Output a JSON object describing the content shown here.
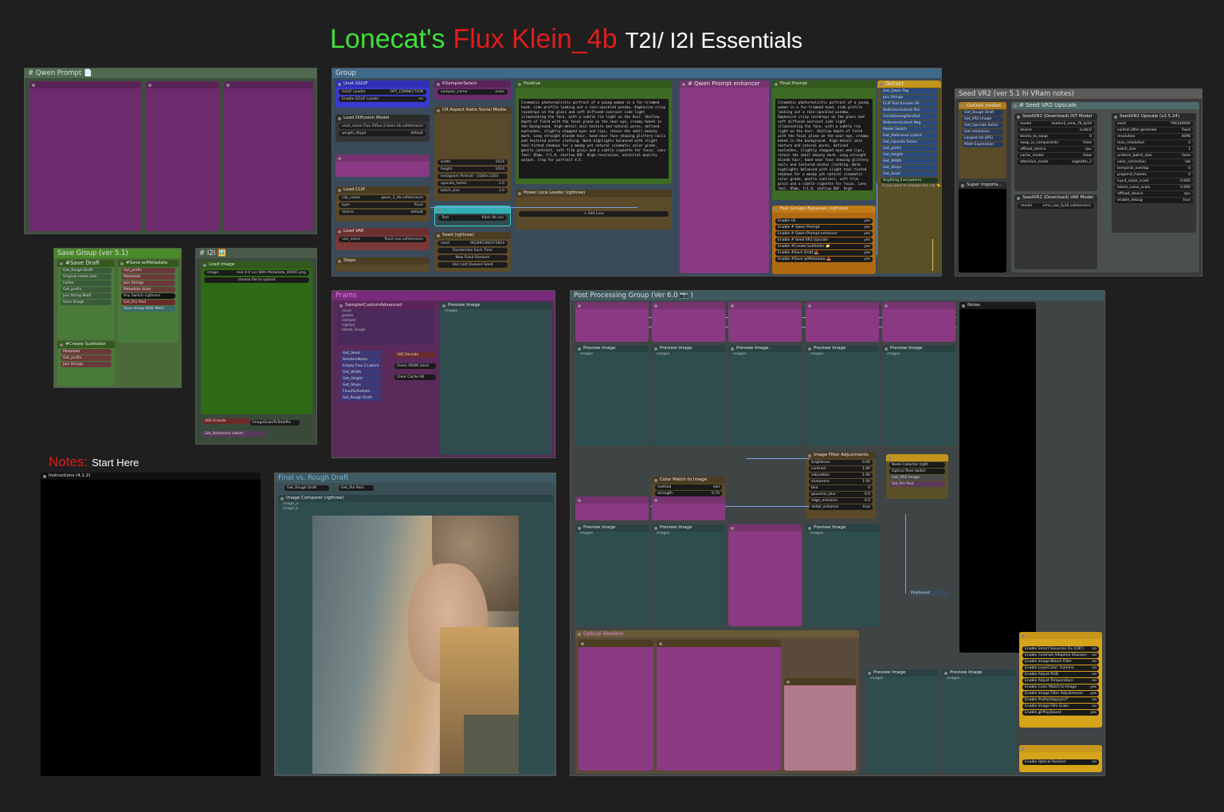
{
  "header": {
    "part1": "Lonecat's",
    "part2": "Flux Klein_4b",
    "part3": "T2I/ I2I Essentials"
  },
  "notes": {
    "label": "Notes:",
    "start": "Start Here"
  },
  "groups": {
    "qwen_prompt": "#  Qwen Prompt 📄",
    "group": "Group",
    "qwen_enhancer": "# Qwen Prompt enhancer",
    "getset": "Getset",
    "seedvr2": "Seed VR2 (ver 5.1 hi VRam notes)",
    "getset_nodes": "Getset nodes",
    "seedvr2_upscale": "# Seed VR2 Upscale",
    "save_group": "Save Group (ver 5.1)",
    "i2i": "#  I2I 🖼️",
    "prams": "Prams",
    "post": "Post Processing Group (Ver 6.0 📷 )",
    "final_vs": "Final vs. Rough Draft",
    "optical": "Optical Realism"
  },
  "nodes": {
    "gguf_loader": "Unet GGUF",
    "gguf_widget": "GGUF Loader",
    "gguf_out": "OPT_CONNECTION",
    "enable_gguf": "Enable GGUF Loader",
    "load_diffusion": "Load Diffusion Model",
    "unet_name": "unet_name",
    "unet_value": "Flux 2\\flux-2-klein-4b.safetensors",
    "weight_dtype": "weight_dtype",
    "weight_value": "default",
    "load_clip": "Load CLIP",
    "clip_name": "clip_name",
    "clip_value": "qwen_3_4b.safetensors",
    "type": "type",
    "type_value": "flux2",
    "device": "device",
    "device_value": "default",
    "load_vae": "Load VAE",
    "vae_name": "vae_name",
    "vae_value": "flux2-vae.safetensors",
    "steps": "Steps",
    "ksampler_select": "KSamplerSelect",
    "sampler_name": "sampler_name",
    "sampler_value": "euler",
    "aspect": "CR Aspect Ratio Social Media",
    "width": "width",
    "width_value": "1024",
    "height": "height",
    "height_value": "1024",
    "aspect_ratio": "Instagram Portrait - 1080×1350",
    "upscale_factor": "upscale_factor",
    "batch_size": "batch_size",
    "one": "1.0",
    "positive": "Positive",
    "positive_text": "Cinematic photorealistic portrait of a young woman in a fur-trimmed hood, side profile looking out a rain-speckled window. Emphasize crisp raindrops on the glass and soft diffused overcast side light illuminating the face, with a subtle rim light on the hair. Shallow depth of field with the focal plane on the near eye, creamy bokeh in the background. High-detail skin texture and natural pores, defined eyelashes, slightly chapped eyes and lips, retain the small beauty mark. Long straight blonde hair, hand near face showing glittery nails and textured winter clothing. Warm highlights balanced with slight teal-tinted shadows for a moody yet natural cinematic color grade, gentle contrast, soft film grain and a subtle vignette for focus. Lens feel: 85mm, f/1.8, shallow DOF. High-resolution, editorial-quality output. Crop for portrait 4:5.",
    "power_lora": "Power Lora Loader (rgthree)",
    "add_lora": "+ Add Lora",
    "text_label": "Text",
    "klein_run": "Klein 4b run",
    "seed": "Seed (rgthree)",
    "seed_value": "962895366375824",
    "randomize": "Randomize Each Time",
    "new_fixed": "New Fixed Random",
    "use_last": "Use Last Queued Seed",
    "final_prompt": "Final Prompt",
    "fast_groups": "Fast Groups Bypasser (rgthree)",
    "bypass_items": [
      "Enable I2I",
      "Enable # Qwen Prompt",
      "Enable # Qwen Prompt enhancer",
      "Enable # Seed VR2 Upscale",
      "Enable #Create Subfolder 📁",
      "Enable #Save Draft 📥",
      "Enable #Save w/Metadata 📥"
    ],
    "yes": "yes",
    "no": "no",
    "getset_items": [
      "Get_Qwen Tag",
      "Join Strings",
      "CLIP Text Encode (Pr",
      "ReferenceLatent Pos",
      "ConditioningZeroOut",
      "ReferenceLatent Neg",
      "Model Switch",
      "Get_Reference Latent",
      "Get_Upscale factor",
      "Get_prefix",
      "Get_Height",
      "Get_Width",
      "Get_Steps",
      "Get_Seed"
    ],
    "anything": "Anything Everywhere",
    "change_cfg": "if you want to change the cfg 👈",
    "getset_nodes_items": [
      "Get_Rough Draft",
      "Set_VR2 Image",
      "Get_Upscale factor",
      "Get resolution",
      "Largest Int (JPS)",
      "Math Expression"
    ],
    "super_import": "Super Importa...",
    "seedvr2_dit": "SeedVR2 (Download) DiT Model",
    "seedvr2_up": "SeedVR2 Upscale (v2.5.24)",
    "seedvr2_vae": "SeedVR2 (Download) VAE Model",
    "seedvr2_model_value": "seedvr2_ema_7b_fp16.safetensors",
    "seedvr2_vae_value": "ema_vae_fp16.safetensors",
    "seedvr_rows": [
      "model",
      "device",
      "blocks_to_swap",
      "swap_io_components",
      "offload_device",
      "cache_model",
      "attention_mode"
    ],
    "seedvr_vals": [
      "seedvr2_ema_7b_fp16",
      "cuda:0",
      "0",
      "false",
      "cpu",
      "false",
      "sageattn_2"
    ],
    "up_rows": [
      "seed",
      "control after generate",
      "resolution",
      "max_resolution",
      "batch_size",
      "uniform_batch_size",
      "color_correction",
      "temporal_overlap",
      "prepend_frames",
      "input_noise_scale",
      "latent_noise_scale",
      "offload_device",
      "enable_debug"
    ],
    "up_vals": [
      "796140000",
      "fixed",
      "4096",
      "0",
      "1",
      "false",
      "lab",
      "0",
      "0",
      "0.000",
      "0.000",
      "cpu",
      "true"
    ],
    "save_draft": "#Save Draft",
    "save_draft_items": [
      "Get_Rough Draft",
      "Original name add...",
      "Folder",
      "Get_prefix",
      "Join String Multi",
      "Save Image"
    ],
    "save_meta": "#Save w/Metadata",
    "save_meta_items": [
      "Get_prefix",
      "Metadata",
      "Join Strings",
      "Metadata Hider"
    ],
    "any_switch": "Any Switch (rgthree)",
    "get_pro_post": "Get_Pro Post",
    "save_meta_node": "Save Image With Meta",
    "create_sub": "#Create Subfolder",
    "sub_items": [
      "Metadata",
      "Get_prefix",
      "Join Strings"
    ],
    "load_image": "Load Image",
    "image_label": "image",
    "image_value": "real 4.0 run With Metadata_00005.png",
    "choose_file": "choose file to upload",
    "vae_encode": "VAE Encode",
    "image_scale": "ImageScaleToTotalPix",
    "set_ref_latent": "Set_Reference Latent",
    "sampler_custom": "SamplerCustomAdvanced",
    "sampler_ports": [
      "noise",
      "guider",
      "sampler",
      "sigmas",
      "latent_image"
    ],
    "sampler_out": [
      "output",
      "denoised_output"
    ],
    "prams_items": [
      "Get_Seed",
      "RandomNoise",
      "Empty Flux 2 Latent",
      "Get_Width",
      "Get_Height",
      "Get_Steps",
      "Flux2Scheduler",
      "Set_Rough Draft"
    ],
    "vae_decode": "VAE Decode",
    "clean_vram": "Clean VRAM Used",
    "clear_cache": "Clear Cache All",
    "preview_image": "Preview Image",
    "images": "images",
    "instructions": "Instructions (4.1.2)",
    "get_rough_draft": "Get_Rough Draft",
    "get_pro_post2": "Get_Pro Post",
    "image_comparer": "Image Comparer (rgthree)",
    "image_a": "image_a",
    "image_b": "image_b",
    "color_match": "Color Match to Image",
    "color_rows": [
      "method",
      "strength",
      "multithread"
    ],
    "color_vals": [
      "mkl",
      "0.70",
      "true"
    ],
    "filter_adj": "Image Filter Adjustments",
    "filter_rows": [
      "brightness",
      "contrast",
      "saturation",
      "sharpness",
      "blur",
      "gaussian_blur",
      "edge_enhance",
      "detail_enhance"
    ],
    "filter_vals": [
      "0.00",
      "1.00",
      "1.00",
      "1.00",
      "0",
      "0.0",
      "0.0",
      "true"
    ],
    "node_collector": "Node Collector (rgth",
    "optical_switch": "Optical Real switch",
    "get_vr2": "Get_VR2 Image",
    "set_pro_post": "Set_Pro Post",
    "play_sound": "PlaySound",
    "notes_node": "Notes",
    "post_bypass": [
      "Enable Smart Gaussian Fix (CBT)",
      "Enable Contrast Adaptive Sharpen",
      "Enable Image Bloom Filter",
      "Enable LayerColor: Gamma",
      "Enable Adjust RGB",
      "Enable Adjust Temperature",
      "Enable Color Match to Image",
      "Enable Image Filter Adjustments",
      "Enable ProPostApplyLUT",
      "Enable Image Film Grain",
      "Enable 🔊PlaySound"
    ],
    "post_bypass_vals": [
      "no",
      "no",
      "no",
      "no",
      "no",
      "no",
      "yes",
      "yes",
      "no",
      "no",
      "yes"
    ],
    "enable_optical": "Enable Optical Realism"
  },
  "colors": {
    "accent_green": "#3fe03a",
    "accent_red": "#e01d1d",
    "wire_blue": "#7aa4e8",
    "wire_yellow": "#e3c857"
  }
}
